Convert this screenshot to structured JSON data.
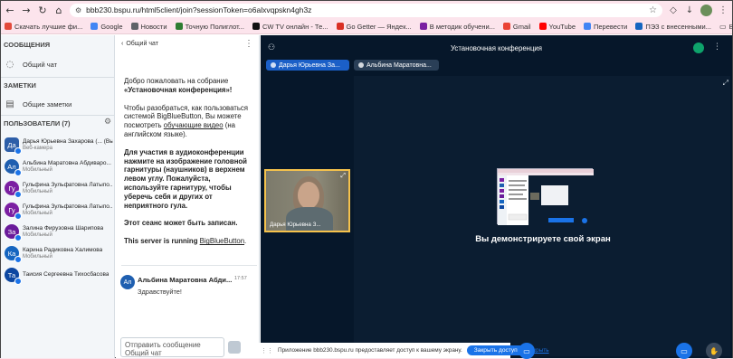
{
  "browser": {
    "url": "bbb230.bspu.ru/html5client/join?sessionToken=o6alxvqpskn4gh3z",
    "bookmarks": [
      {
        "label": "Скачать лучшие фи...",
        "color": "#e34a3b"
      },
      {
        "label": "Google",
        "color": "#4285f4"
      },
      {
        "label": "Новости",
        "color": "#5f6368"
      },
      {
        "label": "Точную Полиглот...",
        "color": "#2e7d32"
      },
      {
        "label": "CW TV онлайн - Те...",
        "color": "#111111"
      },
      {
        "label": "Go Getter — Яндек...",
        "color": "#d93025"
      },
      {
        "label": "В методик обучени...",
        "color": "#7b1fa2"
      },
      {
        "label": "Gmail",
        "color": "#ea4335"
      },
      {
        "label": "YouTube",
        "color": "#ff0000"
      },
      {
        "label": "Перевести",
        "color": "#4285f4"
      },
      {
        "label": "ПЭЗ с внесенными...",
        "color": "#1565c0"
      }
    ],
    "all_bookmarks": "Все закладки"
  },
  "users_panel": {
    "messages_title": "СООБЩЕНИЯ",
    "public_chat": "Общий чат",
    "notes_title": "ЗАМЕТКИ",
    "shared_notes": "Общие заметки",
    "users_title": "ПОЛЬЗОВАТЕЛИ (7)",
    "users": [
      {
        "initials": "Да",
        "name": "Дарья Юрьевна Захарова (... (Вы)",
        "role": "Веб-камера",
        "color": "#2d5ea8",
        "round": false
      },
      {
        "initials": "Ал",
        "name": "Альбина Маратовна Абдиваро...",
        "role": "Мобильный",
        "color": "#1f5fb0",
        "round": true
      },
      {
        "initials": "Гу",
        "name": "Гульфина Зульфатовна Латыпо...",
        "role": "Мобильный",
        "color": "#7b1fa2",
        "round": true
      },
      {
        "initials": "Гу",
        "name": "Гульфина Зульфатовна Латыпо...",
        "role": "Мобильный",
        "color": "#7b1fa2",
        "round": true
      },
      {
        "initials": "За",
        "name": "Залина Фирузовна Шарипова",
        "role": "Мобильный",
        "color": "#6a1b9a",
        "round": true
      },
      {
        "initials": "Ка",
        "name": "Карина Радиковна Халимова",
        "role": "Мобильный",
        "color": "#1565c0",
        "round": true
      },
      {
        "initials": "Та",
        "name": "Таисия Сергеевна Тихосбасова",
        "role": "",
        "color": "#0d47a1",
        "round": true
      }
    ]
  },
  "chat": {
    "title": "Общий чат",
    "welcome_1a": "Добро пожаловать на собрание",
    "welcome_1b": "«Установочная конференция»!",
    "welcome_2a": "Чтобы разобраться, как пользоваться системой BigBlueButton, Вы можете посмотреть ",
    "welcome_2link": "обучающие видео",
    "welcome_2b": " (на английском языке).",
    "welcome_3a": "Для участия в аудиоконференции нажмите на изображение головной гарнитуры (наушников) в верхнем левом углу. ",
    "welcome_3b": "Пожалуйста, используйте гарнитуру, чтобы уберечь себя и других от неприятного гула.",
    "welcome_4": "Этот сеанс может быть записан.",
    "welcome_5a": "This server is running ",
    "welcome_5link": "BigBlueButton",
    "welcome_5b": ".",
    "message": {
      "initials": "Ал",
      "author": "Альбина Маратовна Абди...",
      "time": "17:57",
      "text": "Здравствуйте!"
    },
    "input_placeholder": "Отправить сообщение Общий чат"
  },
  "meeting": {
    "title": "Установочная конференция",
    "talkers": [
      {
        "name": "Дарья Юрьевна За...",
        "color": "#1b5fc7"
      },
      {
        "name": "Альбина Маратовна...",
        "color": "#2a3f57"
      }
    ],
    "video_label": "Дарья Юрьевна З...",
    "share_text": "Вы демонстрируете свой экран"
  },
  "notification": {
    "text": "Приложение bbb230.bspu.ru предоставляет доступ к вашему экрану.",
    "share_button": "Закрыть доступ",
    "hide": "Скрыть"
  }
}
